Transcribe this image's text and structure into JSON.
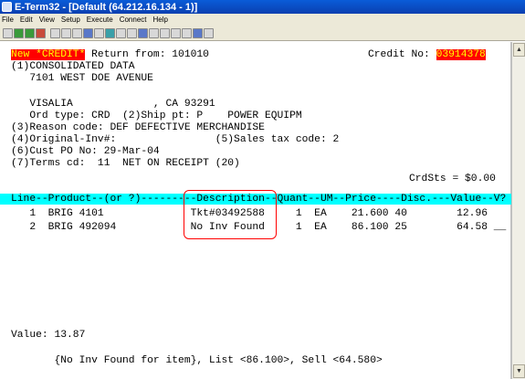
{
  "window": {
    "title": "E-Term32 - [Default (64.212.16.134 - 1)]"
  },
  "menu": [
    {
      "label": "File"
    },
    {
      "label": "Edit"
    },
    {
      "label": "View"
    },
    {
      "label": "Setup"
    },
    {
      "label": "Execute"
    },
    {
      "label": "Connect"
    },
    {
      "label": "Help"
    }
  ],
  "terminal": {
    "header": {
      "new_credit": "New *CREDIT*",
      "return_from": " Return from: 101010",
      "credit_no_label": "Credit No: ",
      "credit_no_value": "03914378"
    },
    "customer_name": "(1)CONSOLIDATED DATA",
    "address1": "   7101 WEST DOE AVENUE",
    "city_line": "   VISALIA             , CA 93291",
    "ord_type_line": "   Ord type: CRD  (2)Ship pt: P    POWER EQUIPM",
    "reason_line": "(3)Reason code: DEF DEFECTIVE MERCHANDISE",
    "orig_inv_line": "(4)Original-Inv#:                (5)Sales tax code: 2",
    "cust_po_line": "(6)Cust PO No: 29-Mar-04",
    "terms_line": "(7)Terms cd:  11  NET ON RECEIPT (20)",
    "crdsts_line": "CrdSts = $0.00",
    "column_header": "Line--Product--(or ?)---------Description--Quant--UM--Price----Disc.---Value--V?",
    "rows": [
      {
        "text": "   1  BRIG 4101              Tkt#03492588     1  EA    21.600 40        12.96"
      },
      {
        "text": "   2  BRIG 492094            No Inv Found     1  EA    86.100 25        64.58 __"
      }
    ],
    "value_line": "Value: 13.87",
    "status_line": "       {No Inv Found for item}, List <86.100>, Sell <64.580>"
  },
  "colors": {
    "title_bar": "#0a4fd0",
    "highlight_red": "#ff0000",
    "highlight_yellow": "#ffff00",
    "header_cyan": "#00ffff",
    "callout_red": "#ff0000"
  }
}
